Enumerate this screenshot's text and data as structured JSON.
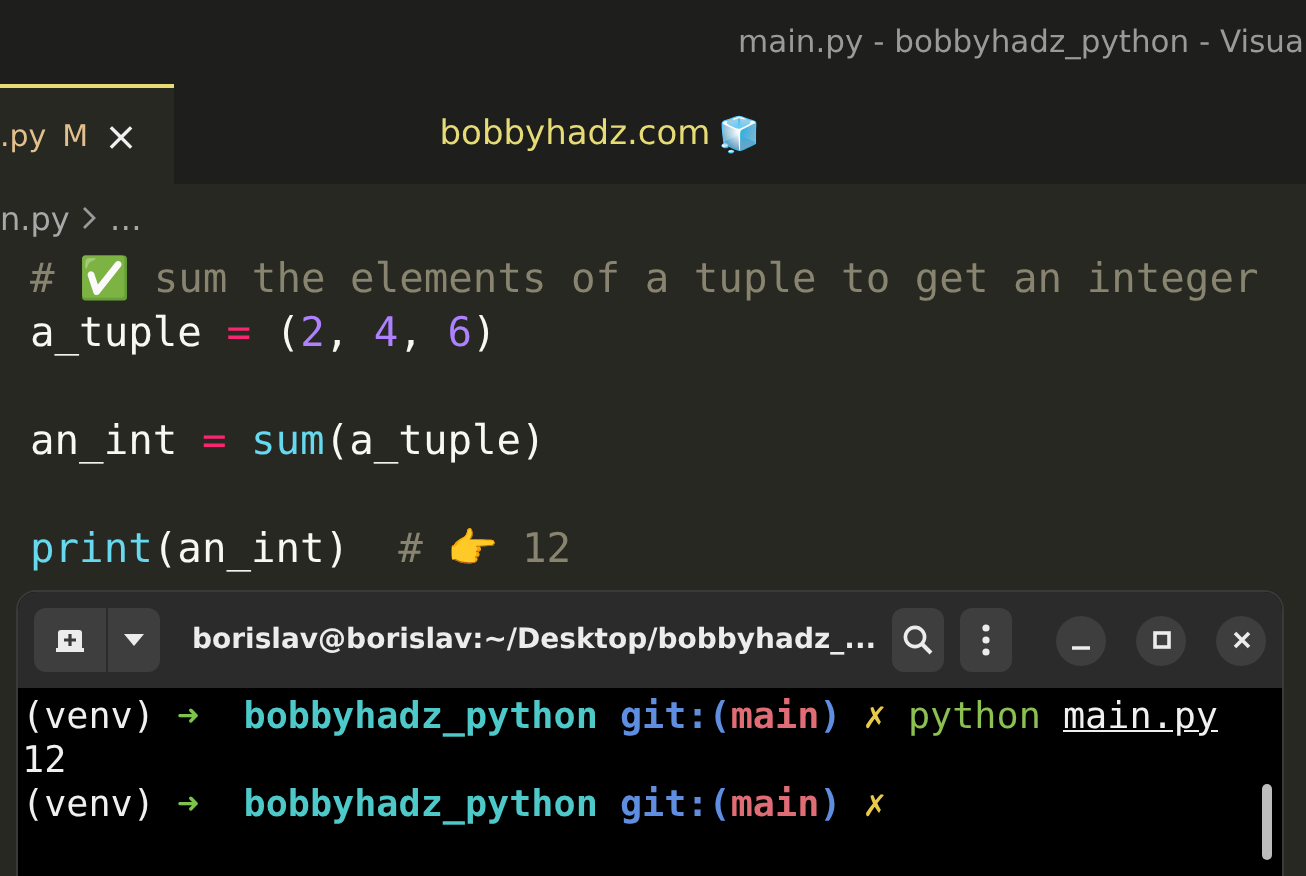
{
  "window": {
    "title": "main.py - bobbyhadz_python - Visua"
  },
  "tab": {
    "label": ".py",
    "badge": "M",
    "close": "×",
    "selected": true
  },
  "banner": {
    "text": "bobbyhadz.com",
    "emoji": "🧊"
  },
  "breadcrumb": {
    "file": "n.py",
    "rest": "…"
  },
  "code_lines": [
    {
      "kind": "code",
      "tokens": [
        {
          "text": "# ✅ sum the elements of a tuple to get an integer",
          "kind": "comment"
        }
      ]
    },
    {
      "kind": "code",
      "tokens": [
        {
          "text": "a_tuple ",
          "kind": "plain"
        },
        {
          "text": "=",
          "kind": "op"
        },
        {
          "text": " (",
          "kind": "plain"
        },
        {
          "text": "2",
          "kind": "num"
        },
        {
          "text": ", ",
          "kind": "plain"
        },
        {
          "text": "4",
          "kind": "num"
        },
        {
          "text": ", ",
          "kind": "plain"
        },
        {
          "text": "6",
          "kind": "num"
        },
        {
          "text": ")",
          "kind": "plain"
        }
      ]
    },
    {
      "kind": "blank"
    },
    {
      "kind": "code",
      "tokens": [
        {
          "text": "an_int ",
          "kind": "plain"
        },
        {
          "text": "= ",
          "kind": "op"
        },
        {
          "text": "sum",
          "kind": "func"
        },
        {
          "text": "(a_tuple)",
          "kind": "plain"
        }
      ]
    },
    {
      "kind": "blank"
    },
    {
      "kind": "code",
      "tokens": [
        {
          "text": "print",
          "kind": "func"
        },
        {
          "text": "(an_int)  ",
          "kind": "plain"
        },
        {
          "text": "# 👉 12",
          "kind": "comment"
        }
      ]
    }
  ],
  "terminal": {
    "title": "borislav@borislav:~/Desktop/bobbyhadz_...",
    "lines": [
      {
        "tokens": [
          {
            "text": "(venv) ",
            "kind": "plain"
          },
          {
            "text": "➜ ",
            "kind": "arrow"
          },
          {
            "text": " bobbyhadz_python ",
            "kind": "dir"
          },
          {
            "text": "git:(",
            "kind": "git"
          },
          {
            "text": "main",
            "kind": "branch"
          },
          {
            "text": ") ",
            "kind": "git"
          },
          {
            "text": "✗ ",
            "kind": "dirty"
          },
          {
            "text": "python ",
            "kind": "cmd"
          },
          {
            "text": "main.py",
            "kind": "arg"
          }
        ]
      },
      {
        "tokens": [
          {
            "text": "12",
            "kind": "plain"
          }
        ]
      },
      {
        "tokens": [
          {
            "text": "(venv) ",
            "kind": "plain"
          },
          {
            "text": "➜ ",
            "kind": "arrow"
          },
          {
            "text": " bobbyhadz_python ",
            "kind": "dir"
          },
          {
            "text": "git:(",
            "kind": "git"
          },
          {
            "text": "main",
            "kind": "branch"
          },
          {
            "text": ") ",
            "kind": "git"
          },
          {
            "text": "✗",
            "kind": "dirty"
          }
        ]
      }
    ]
  }
}
